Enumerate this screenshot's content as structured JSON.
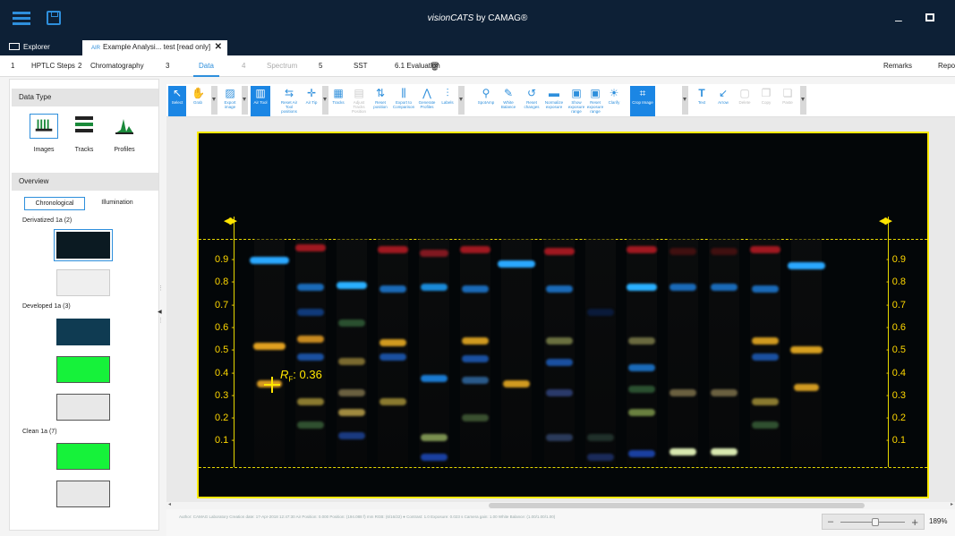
{
  "app": {
    "title_italic": "visionCATS",
    "title_rest": " by CAMAG®"
  },
  "icons": {
    "menu": "hamburger-menu-icon",
    "save": "save-icon",
    "minimize": "minimize-icon",
    "maximize": "restore-window-icon"
  },
  "tabs": [
    {
      "label": "Explorer",
      "icon": "folder-icon"
    },
    {
      "prefix": "AIR",
      "label": "Example Analysi... test [read only]",
      "close": "✕"
    }
  ],
  "steps": [
    {
      "num": "1",
      "label": "HPTLC Steps"
    },
    {
      "num": "2",
      "label": "Chromatography"
    },
    {
      "num": "3",
      "label": "Data"
    },
    {
      "num": "4",
      "label": "Spectrum"
    },
    {
      "num": "5",
      "label": "SST"
    },
    {
      "num": "",
      "label": "6.1 Evaluation"
    },
    {
      "num": "",
      "label": "Remarks"
    },
    {
      "num": "",
      "label": "Repo"
    }
  ],
  "left_panel": {
    "data_type_title": "Data Type",
    "data_types": [
      "Images",
      "Tracks",
      "Profiles"
    ],
    "overview_title": "Overview",
    "segments": [
      "Chronological",
      "Illumination"
    ],
    "groups": [
      "Derivatized 1a (2)",
      "Developed 1a (3)",
      "Clean 1a (7)"
    ]
  },
  "toolbar": {
    "tools": [
      "Select",
      "Grab",
      "Export image",
      "Air Tool",
      "Reset Air Tool positions",
      "Air Tip",
      "Tracks",
      "Adjust Tracks Position",
      "Reset position",
      "Export to Comparison",
      "Generate Profiles",
      "Labels",
      "SpotAmp",
      "White Balance",
      "Reset changes",
      "Normalize exposure",
      "Show exposure range",
      "Reset exposure range",
      "Clarify",
      "Crop Image",
      "Text",
      "Arrow",
      "Delete",
      "Copy",
      "Paste"
    ]
  },
  "plate": {
    "rf_labels": [
      "0.9",
      "0.8",
      "0.7",
      "0.6",
      "0.5",
      "0.4",
      "0.3",
      "0.2",
      "0.1"
    ],
    "rf_readout_prefix": "R",
    "rf_readout_sub": "F",
    "rf_readout_value": ": 0.36",
    "arrows": "◀▶"
  },
  "status": {
    "metadata": "Author: CAMAG Laboratory   Creation date: 17-Apr-2018 12:47:30   Air Position: 0.000   Position: (194.088 f) mm   RGB: (6/16/22)   ●  Contrast: 1.0   Exposure: 0.023 s   Camera gain: 1.00   White Balance: (1.00/1.00/1.00)",
    "zoom": "189%"
  },
  "colors": {
    "accent": "#2e8fdc",
    "titlebar": "#0d2036",
    "plate_border": "#ffea00"
  }
}
